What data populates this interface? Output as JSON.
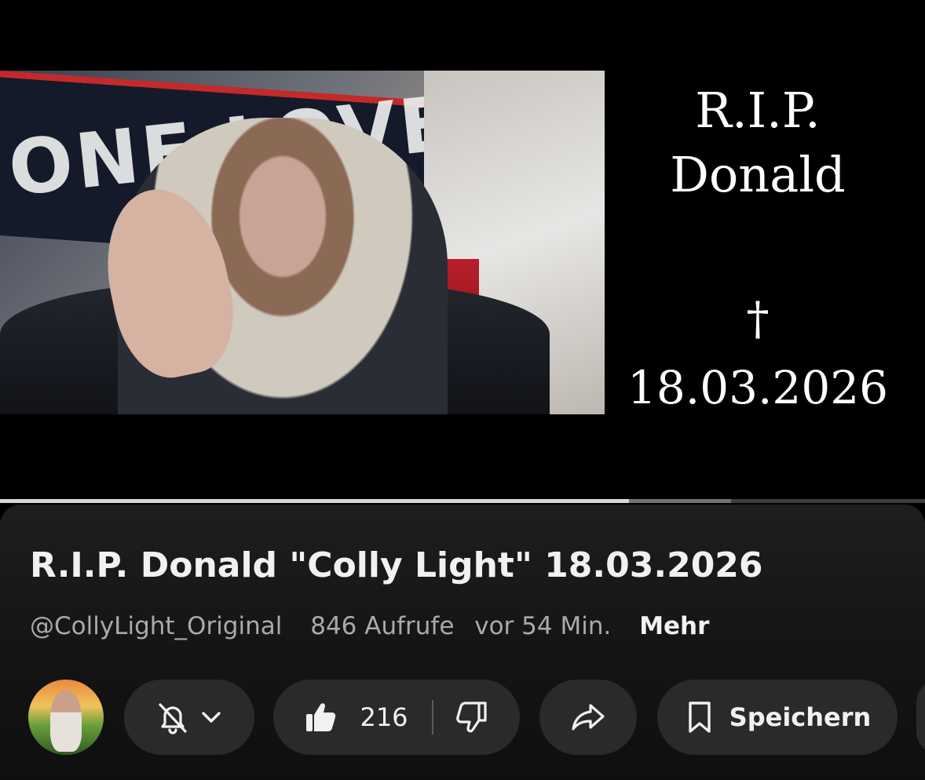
{
  "video": {
    "overlay_title": "R.I.P.\nDonald",
    "overlay_cross": "†",
    "overlay_date": "18.03.2026",
    "banner_text": "ONE LOVE"
  },
  "progress": {
    "played_fraction": 0.68,
    "buffered_fraction": 0.79
  },
  "info": {
    "title": "R.I.P. Donald \"Colly Light\" 18.03.2026",
    "channel": "@CollyLight_Original",
    "views": "846 Aufrufe",
    "age": "vor 54 Min.",
    "more_label": "Mehr"
  },
  "actions": {
    "like_count": "216",
    "save_label": "Speichern",
    "icons": [
      "bell-off-icon",
      "chevron-down-icon",
      "thumbs-up-icon",
      "thumbs-down-icon",
      "share-icon",
      "bookmark-icon"
    ]
  },
  "colors": {
    "pill_bg": "#2a2a2a",
    "text_primary": "#f1f1f1",
    "text_secondary": "#aaaaaa",
    "progress_played": "#d8d8d8"
  }
}
